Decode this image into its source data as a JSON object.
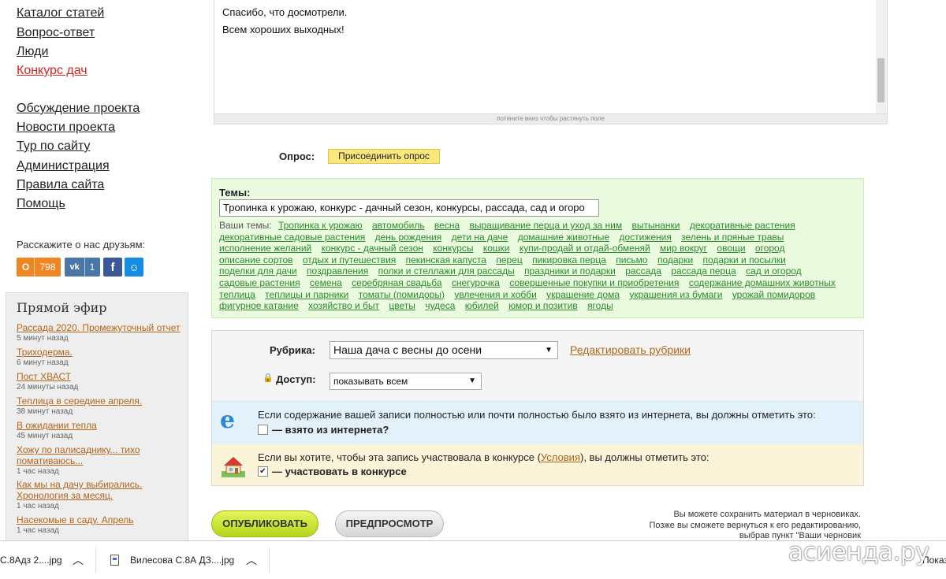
{
  "sidebar": {
    "nav_top": [
      "Каталог статей",
      "Вопрос-ответ",
      "Люди",
      "Конкурс дач"
    ],
    "nav_bottom": [
      "Обсуждение проекта",
      "Новости проекта",
      "Тур по сайту",
      "Администрация",
      "Правила сайта",
      "Помощь"
    ],
    "share_label": "Расскажите о нас друзьям:",
    "share": {
      "ok_count": "798",
      "vk_count": "1"
    },
    "live": {
      "title": "Прямой эфир",
      "items": [
        {
          "title": "Рассада 2020. Промежуточный отчет",
          "time": "5 минут назад"
        },
        {
          "title": "Триходерма.",
          "time": "6 минут назад"
        },
        {
          "title": "Пост ХВАСТ",
          "time": "24 минуты назад"
        },
        {
          "title": "Теплица в середине апреля.",
          "time": "38 минут назад"
        },
        {
          "title": "В ожидании тепла",
          "time": "45 минут назад"
        },
        {
          "title": "Хожу по палисаднику... тихо помативаюсь...",
          "time": "1 час назад"
        },
        {
          "title": "Как мы на дачу выбирались. Хронология за месяц.",
          "time": "1 час назад"
        },
        {
          "title": "Насекомые в саду. Апрель",
          "time": "1 час назад"
        }
      ]
    }
  },
  "editor": {
    "lines": [
      "Спасибо, что досмотрели.",
      "Всем хороших выходных!"
    ],
    "resize_hint": "потяните вниз чтобы растянуть поле"
  },
  "poll": {
    "label": "Опрос:",
    "button": "Присоединить опрос"
  },
  "topics": {
    "label": "Темы:",
    "input_value": "Тропинка к урожаю, конкурс - дачный сезон, конкурсы, рассада, сад и огоро",
    "your_topics_label": "Ваши темы:",
    "tags": [
      "Тропинка к урожаю",
      "автомобиль",
      "весна",
      "выращивание перца и уход за ним",
      "вытынанки",
      "декоративные растения",
      "декоративные садовые растения",
      "день рождения",
      "дети на даче",
      "домашние животные",
      "достижения",
      "зелень и пряные травы",
      "исполнение желаний",
      "конкурс - дачный сезон",
      "конкурсы",
      "кошки",
      "купи-продай и отдай-обменяй",
      "мир вокруг",
      "овощи",
      "огород",
      "описание сортов",
      "отдых и путешествия",
      "пекинская капуста",
      "перец",
      "пикировка перца",
      "письмо",
      "подарки",
      "подарки и посылки",
      "поделки для дачи",
      "поздравления",
      "полки и стеллажи для рассады",
      "праздники и подарки",
      "рассада",
      "рассада перца",
      "сад и огород",
      "садовые растения",
      "семена",
      "серебряная свадьба",
      "снегурочка",
      "совершенные покупки и приобретения",
      "содержание домашних животных",
      "теплица",
      "теплицы и парники",
      "томаты (помидоры)",
      "увлечения и хобби",
      "украшение дома",
      "украшения из бумаги",
      "урожай помидоров",
      "фигурное катание",
      "хозяйство и быт",
      "цветы",
      "чудеса",
      "юбилей",
      "юмор и позитив",
      "ягоды"
    ]
  },
  "settings": {
    "rubric_label": "Рубрика:",
    "rubric_value": "Наша дача с весны до осени",
    "edit_rubrics": "Редактировать рубрики",
    "access_label": "Доступ:",
    "access_value": "показывать всем",
    "internet_text": "Если содержание вашей записи полностью или почти полностью было взято из интернета, вы должны отметить это:",
    "internet_check": "— взято из интернета?",
    "contest_text_before": "Если вы хотите, чтобы эта запись участвовала в конкурсе (",
    "contest_link": "Условия",
    "contest_text_after": "), вы должны отметить это:",
    "contest_check": "— участвовать в конкурсе"
  },
  "actions": {
    "publish": "ОПУБЛИКОВАТЬ",
    "preview": "ПРЕДПРОСМОТР",
    "draft_lines": [
      "Вы можете сохранить материал в черновиках.",
      "Позже вы сможете вернуться к его редактированию,",
      "выбрав пункт \"Ваши черновик"
    ]
  },
  "downloads": {
    "item1": "С.8Адз 2....jpg",
    "item2": "Вилесова С.8А ДЗ....jpg",
    "show_all": "Показ"
  },
  "watermark": "асиенда.ру",
  "colors": {
    "tag_green": "#2c8a2c",
    "link_orange": "#b4651a",
    "nav_red": "#dd2222",
    "publish_green": "#c6e22c"
  }
}
